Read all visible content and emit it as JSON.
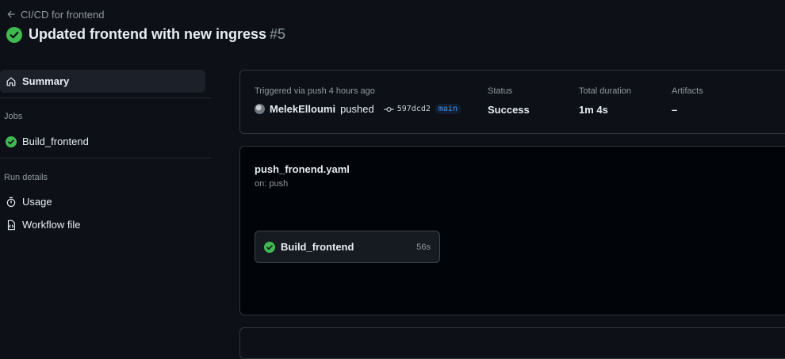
{
  "header": {
    "back_label": "CI/CD for frontend",
    "title": "Updated frontend with new ingress",
    "run_number": "#5"
  },
  "sidebar": {
    "summary_label": "Summary",
    "jobs_heading": "Jobs",
    "jobs": [
      {
        "label": "Build_frontend",
        "status": "success"
      }
    ],
    "run_details_heading": "Run details",
    "usage_label": "Usage",
    "workflow_file_label": "Workflow file"
  },
  "summary": {
    "trigger_label": "Triggered via push 4 hours ago",
    "actor": "MelekElloumi",
    "action": "pushed",
    "commit": "597dcd2",
    "branch": "main",
    "status_label": "Status",
    "status_value": "Success",
    "duration_label": "Total duration",
    "duration_value": "1m 4s",
    "artifacts_label": "Artifacts",
    "artifacts_value": "–"
  },
  "workflow": {
    "file": "push_fronend.yaml",
    "on": "on: push",
    "job": {
      "name": "Build_frontend",
      "duration": "56s",
      "status": "success"
    }
  },
  "colors": {
    "success": "#3fb950",
    "background": "#0d1117",
    "graph_background": "#010409",
    "border": "#30363d",
    "branch_text": "#4493f8"
  },
  "icons": {
    "back": "arrow-left-icon",
    "status": "check-circle-fill-icon",
    "summary": "home-icon",
    "usage": "stopwatch-icon",
    "workflow_file": "file-code-icon",
    "commit": "git-commit-icon"
  }
}
